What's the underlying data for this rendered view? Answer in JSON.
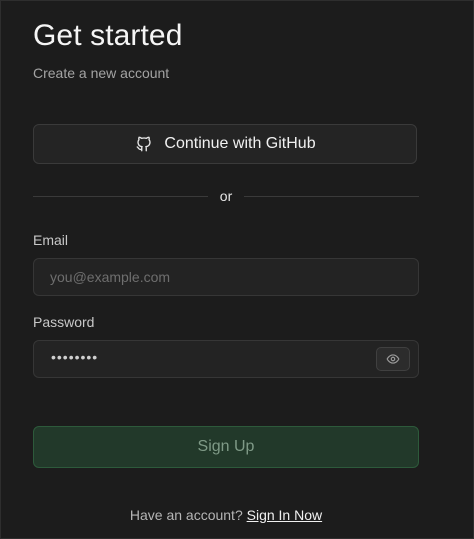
{
  "header": {
    "title": "Get started",
    "subtitle": "Create a new account"
  },
  "oauth": {
    "github_label": "Continue with GitHub",
    "github_icon": "github-icon"
  },
  "divider": {
    "text": "or"
  },
  "form": {
    "email": {
      "label": "Email",
      "value": "",
      "placeholder": "you@example.com"
    },
    "password": {
      "label": "Password",
      "masked_value": "••••••••",
      "toggle_icon": "eye-icon"
    },
    "submit_label": "Sign Up"
  },
  "footer": {
    "prompt": "Have an account? ",
    "link_label": "Sign In Now"
  },
  "colors": {
    "background": "#1c1c1c",
    "brand_green_bg": "#22392a",
    "brand_green_border": "#2d5a3b"
  }
}
